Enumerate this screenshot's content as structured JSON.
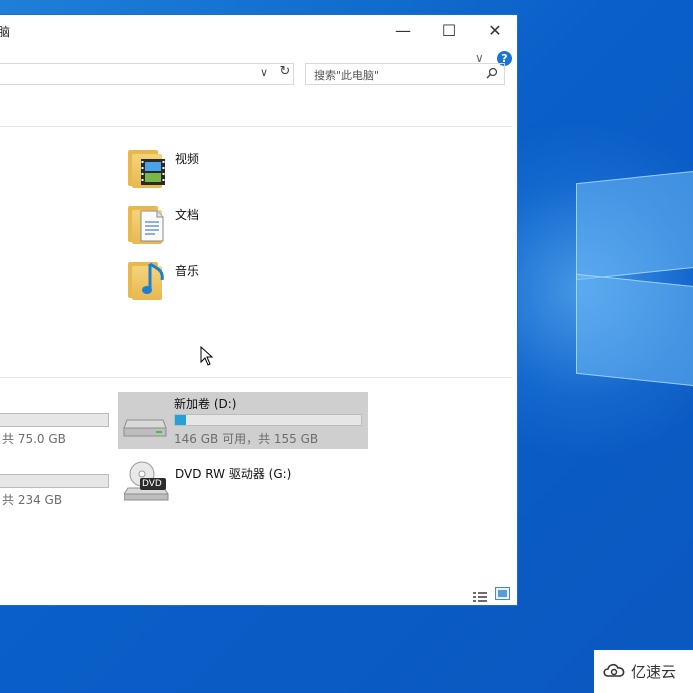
{
  "window": {
    "title_fragment": "脑",
    "minimize_symbol": "—",
    "maximize_symbol": "☐",
    "close_symbol": "✕"
  },
  "ribbon": {
    "expand_symbol": "∨",
    "help_symbol": "?"
  },
  "address": {
    "dropdown_symbol": "∨",
    "refresh_symbol": "↻"
  },
  "search": {
    "placeholder": "搜索\"此电脑\""
  },
  "folders": [
    {
      "label": "视频",
      "icon": "video-folder-icon"
    },
    {
      "label": "文档",
      "icon": "documents-folder-icon"
    },
    {
      "label": "音乐",
      "icon": "music-folder-icon"
    }
  ],
  "drives_left": [
    {
      "info": "共 75.0 GB",
      "used_fraction": 0.7
    },
    {
      "info": "共 234 GB",
      "used_fraction": 0.3
    }
  ],
  "drive_d": {
    "name": "新加卷 (D:)",
    "info": "146 GB 可用，共 155 GB",
    "used_fraction": 0.06,
    "bar_color": "#26a0da"
  },
  "dvd": {
    "name": "DVD RW 驱动器 (G:)",
    "badge": "DVD"
  },
  "watermark": {
    "text": "亿速云"
  },
  "colors": {
    "desktop": "#0b5fc8",
    "selection": "#cfcfcf",
    "accent": "#1a73d9"
  }
}
